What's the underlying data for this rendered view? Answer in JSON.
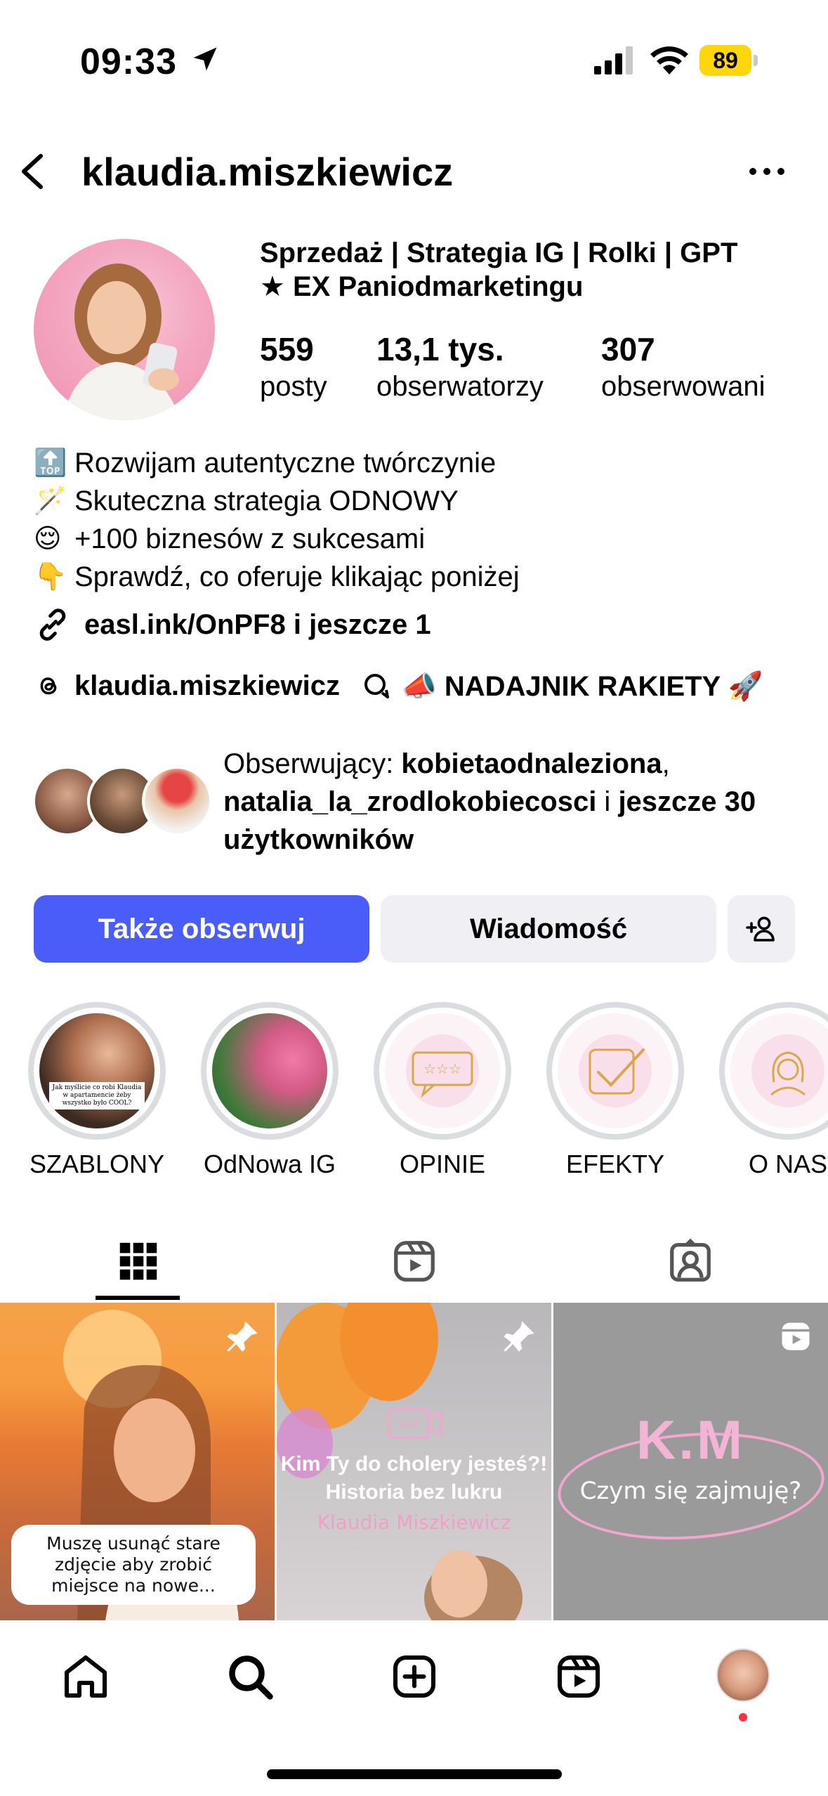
{
  "status_bar": {
    "time": "09:33",
    "battery": "89",
    "battery_color": "#ffd60a"
  },
  "header": {
    "title": "klaudia.miszkiewicz"
  },
  "profile": {
    "headline_line1": "Sprzedaż | Strategia IG |  Rolki | GPT",
    "headline_line2": "★ EX Paniodmarketingu",
    "stats": [
      {
        "value": "559",
        "label": "posty"
      },
      {
        "value": "13,1 tys.",
        "label": "obserwatorzy"
      },
      {
        "value": "307",
        "label": "obserwowani"
      }
    ],
    "bio": [
      {
        "emoji": "🔝",
        "text": "Rozwijam autentyczne twórczynie"
      },
      {
        "emoji": "🪄",
        "text": "Skuteczna strategia ODNOWY"
      },
      {
        "emoji": "😌",
        "text": " +100 biznesów z sukcesami"
      },
      {
        "emoji": "👇",
        "text": "Sprawdź, co oferuje klikając poniżej"
      }
    ],
    "link": "easl.ink/OnPF8 i jeszcze 1",
    "threads_handle": "klaudia.miszkiewicz",
    "channel": "📣 NADAJNIK RAKIETY 🚀",
    "mutuals": {
      "prefix": "Obserwujący: ",
      "first": "kobietaodnaleziona",
      "sep": ", ",
      "second": "natalia_la_zrodlokobiecosci",
      "middle": " i ",
      "rest": "jeszcze 30 użytkowników"
    }
  },
  "buttons": {
    "follow": "Także obserwuj",
    "message": "Wiadomość",
    "follow_color": "#4a5df9"
  },
  "highlights": [
    {
      "label": "SZABLONY"
    },
    {
      "label": "OdNowa IG"
    },
    {
      "label": "OPINIE"
    },
    {
      "label": "EFEKTY"
    },
    {
      "label": "O NAS"
    }
  ],
  "tabs": [
    {
      "icon": "grid-icon",
      "active": true
    },
    {
      "icon": "reels-icon",
      "active": false
    },
    {
      "icon": "tagged-icon",
      "active": false
    }
  ],
  "posts": [
    {
      "caption": "Muszę usunąć stare zdjęcie aby zrobić miejsce na nowe..."
    },
    {
      "live_label": "LIVE",
      "title": "Kim Ty do cholery jesteś?! Historia bez lukru",
      "subtitle": "Klaudia Miszkiewicz"
    },
    {
      "logo": "K.M",
      "subtitle": "Czym się zajmuję?"
    }
  ],
  "highlight_small": {
    "text": "Jak myślicie co robi Klaudia w apartamencie żeby wszystko było COOL?"
  },
  "nav": [
    "home-icon",
    "search-icon",
    "create-icon",
    "reels-icon",
    "profile-avatar"
  ]
}
